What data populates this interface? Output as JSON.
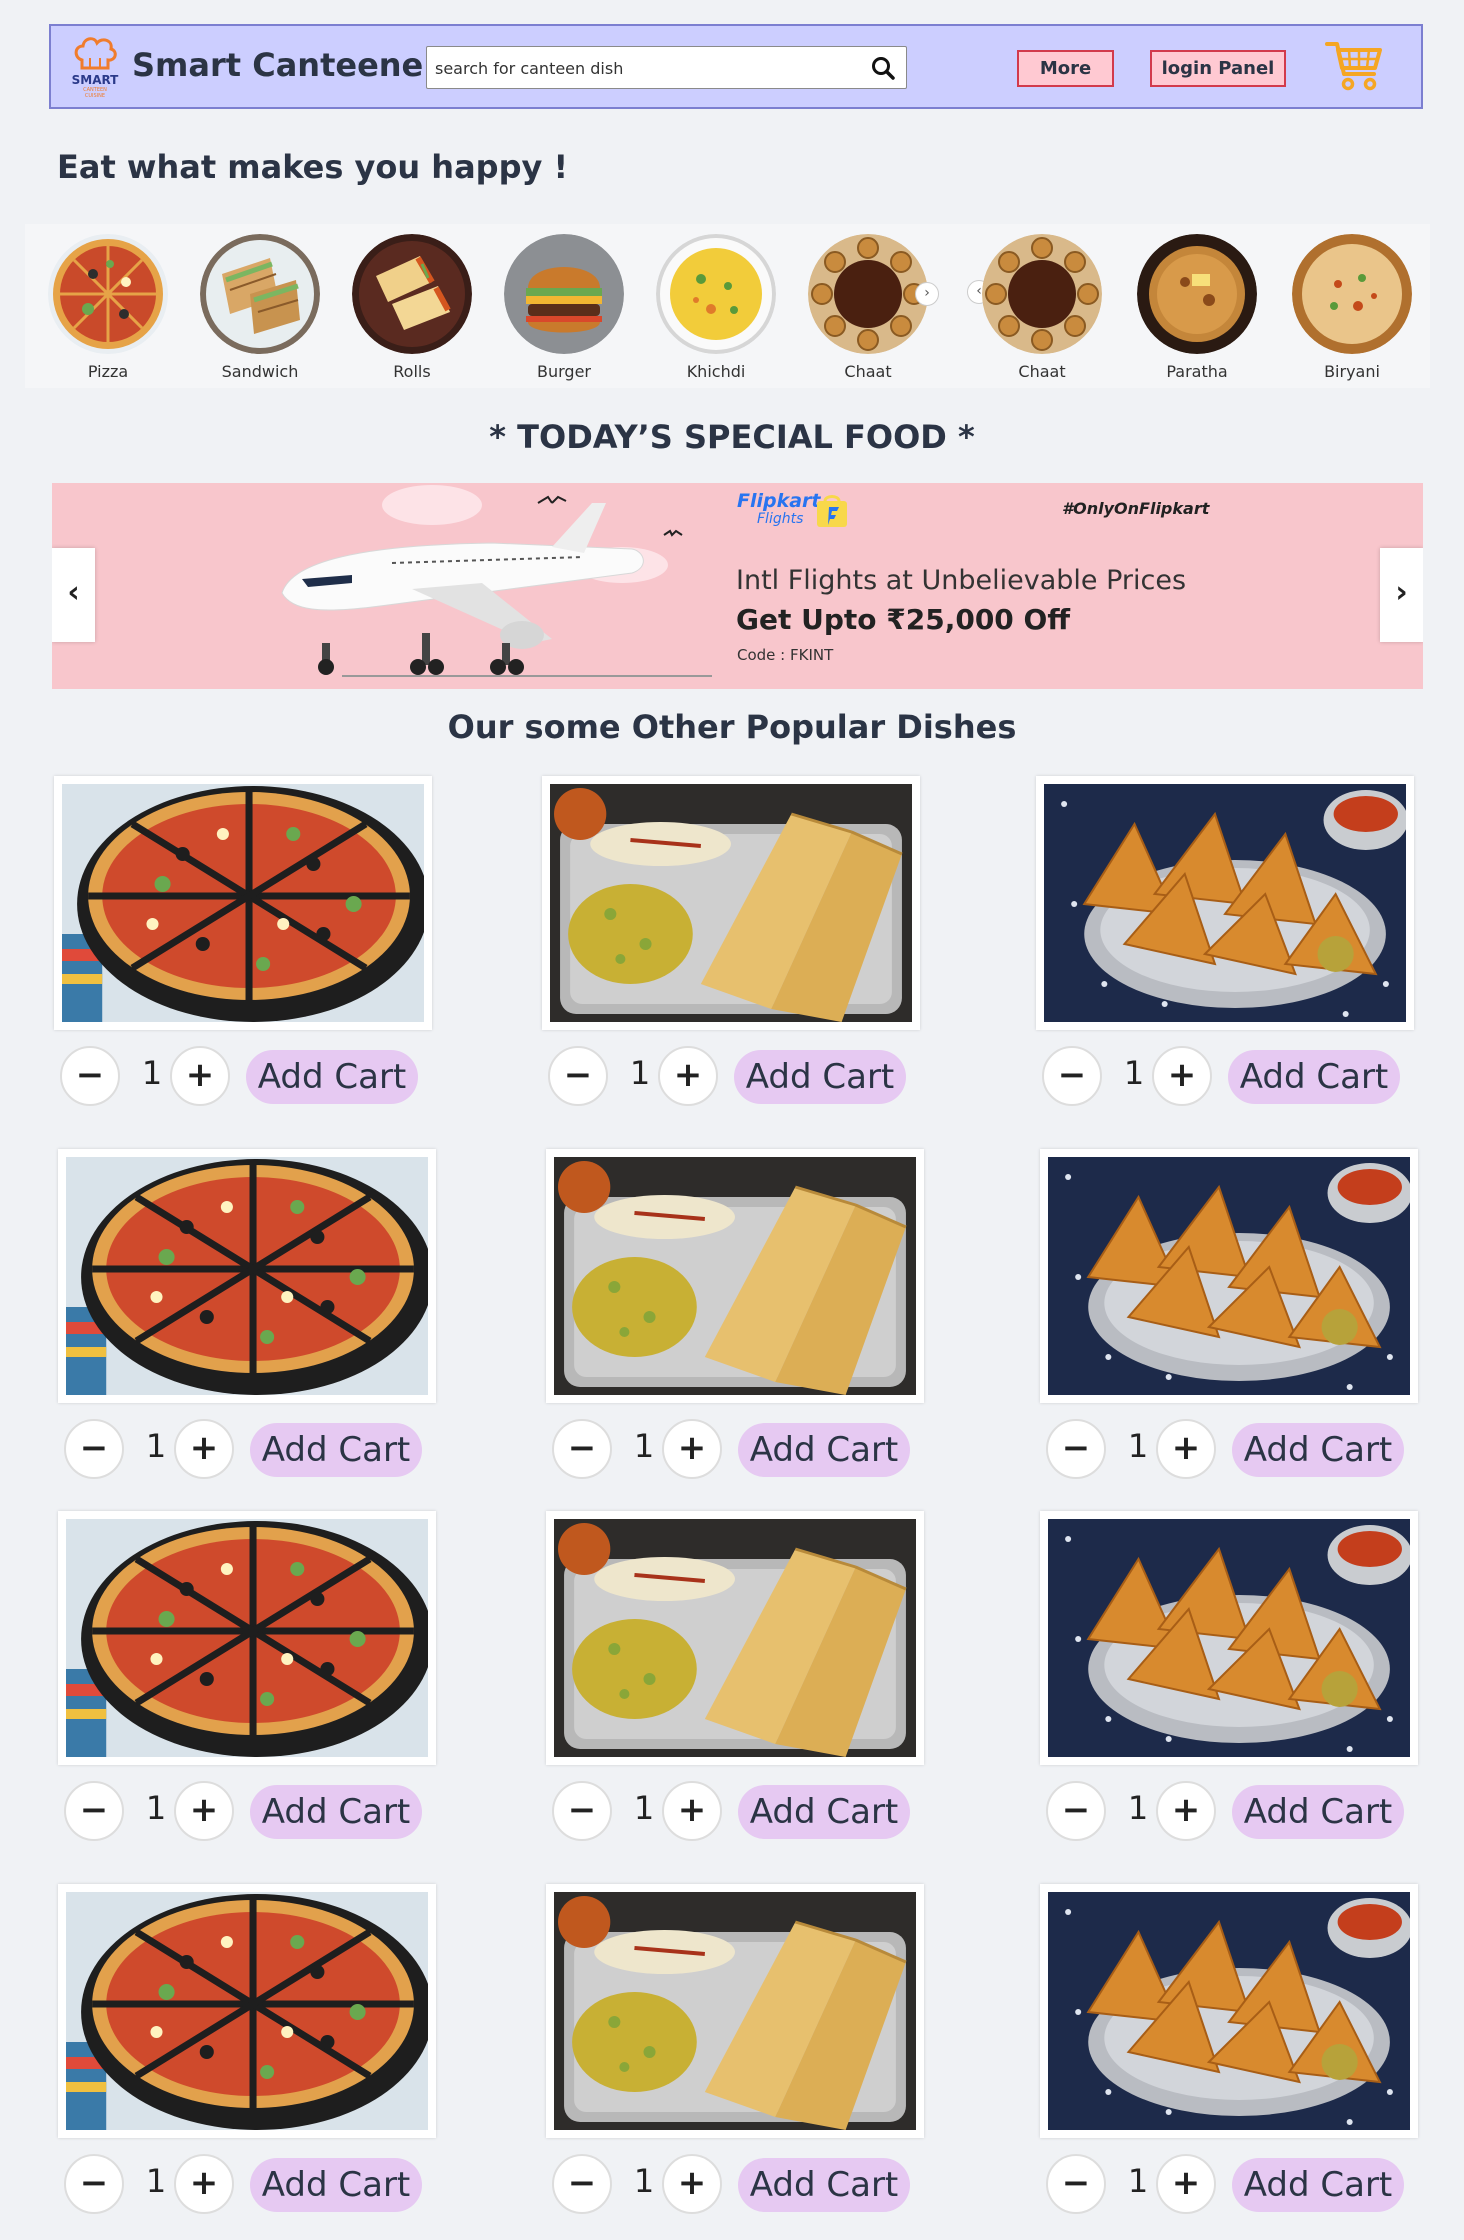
{
  "header": {
    "brand": "Smart Canteene",
    "logo_text": "SMART",
    "search_placeholder": "search for canteen dish",
    "more_label": "More",
    "login_label": "login Panel"
  },
  "tagline": "Eat what makes you happy !",
  "categories": [
    {
      "name": "Pizza",
      "icon": "pizza-icon"
    },
    {
      "name": "Sandwich",
      "icon": "sandwich-icon"
    },
    {
      "name": "Rolls",
      "icon": "rolls-icon"
    },
    {
      "name": "Burger",
      "icon": "burger-icon"
    },
    {
      "name": "Khichdi",
      "icon": "khichdi-icon"
    },
    {
      "name": "Chaat",
      "icon": "chaat-icon"
    },
    {
      "name": "Chaat",
      "icon": "chaat-icon"
    },
    {
      "name": "Paratha",
      "icon": "paratha-icon"
    },
    {
      "name": "Biryani",
      "icon": "biryani-icon"
    }
  ],
  "special_title": "* TODAY’S SPECIAL FOOD *",
  "banner": {
    "brand": "Flipkart",
    "brand_sub": "Flights",
    "hashtag": "#OnlyOnFlipkart",
    "line1": "Intl Flights at Unbelievable Prices",
    "line2": "Get Upto ₹25,000 Off",
    "code": "Code : FKINT"
  },
  "popular_title": "Our some Other Popular Dishes",
  "dish": {
    "add_label": "Add Cart",
    "minus": "−",
    "plus": "+",
    "qty": "1",
    "types": [
      "pizza",
      "dosa",
      "samosa"
    ]
  },
  "colors": {
    "header_bg": "#ccceff",
    "button_bg": "#ffc9d2",
    "button_border": "#d23a4c",
    "banner_bg": "#f8c6cc",
    "add_cart_bg": "#e6c9f2",
    "text": "#2b3445"
  }
}
